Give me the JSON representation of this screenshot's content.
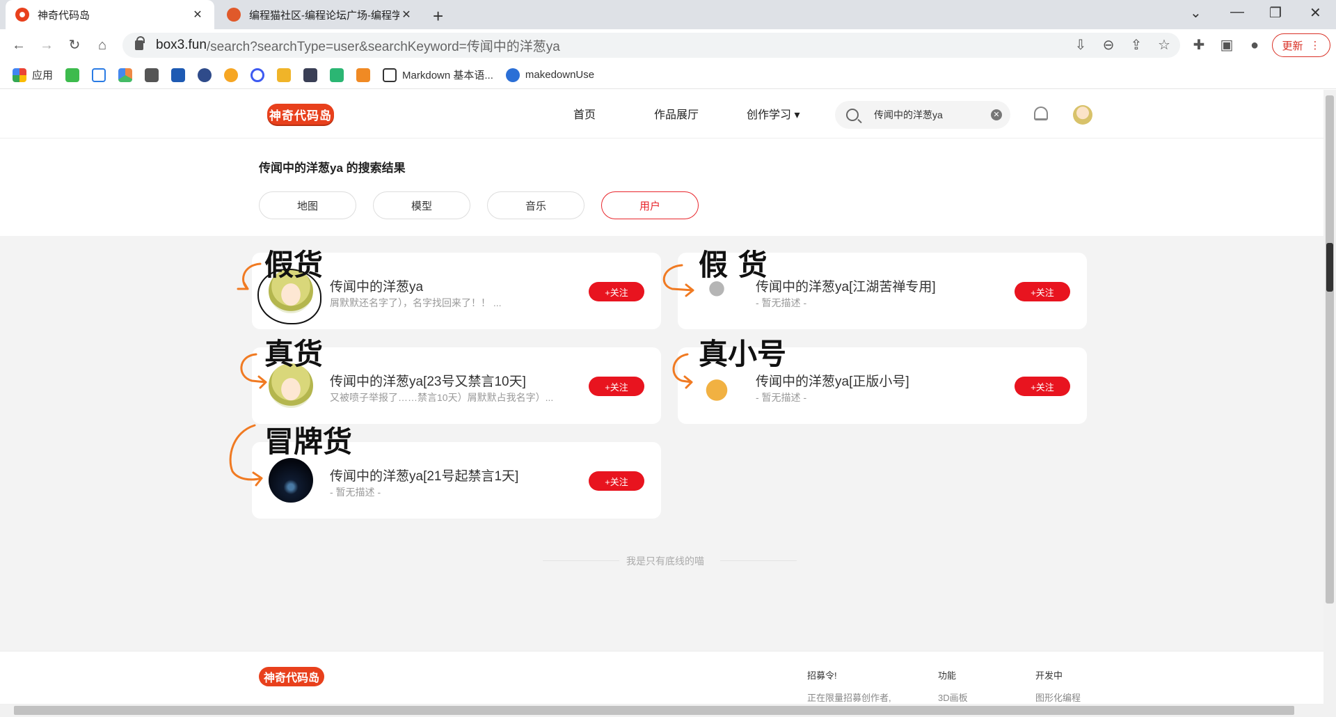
{
  "browser": {
    "tabs": [
      {
        "title": "神奇代码岛",
        "active": true
      },
      {
        "title": "编程猫社区-编程论坛广场-编程学",
        "active": false
      }
    ],
    "address": {
      "domain": "box3.fun",
      "path": "/search?searchType=user&searchKeyword=传闻中的洋葱ya"
    },
    "update_label": "更新",
    "bookmarks": [
      {
        "label": "应用",
        "icon": "apps-grid-icon"
      },
      {
        "label": "Markdown 基本语...",
        "icon": "markdown-icon"
      },
      {
        "label": "makedownUse",
        "icon": "edge-icon"
      }
    ]
  },
  "site": {
    "logo_text": "神奇代码岛",
    "nav": {
      "home": "首页",
      "gallery": "作品展厅",
      "learn": "创作学习 ▾"
    },
    "search": {
      "value": "传闻中的洋葱ya"
    }
  },
  "results": {
    "title": "传闻中的洋葱ya 的搜索结果",
    "tabs": [
      "地图",
      "模型",
      "音乐",
      "用户"
    ],
    "active_tab": "用户",
    "follow_label": "+关注",
    "users": [
      {
        "name": "传闻中的洋葱ya",
        "desc": "屑默默还名字了），名字找回来了！！ ...",
        "avatar": "anime-avatar"
      },
      {
        "name": "传闻中的洋葱ya[江湖苦禅专用]",
        "desc": "- 暂无描述 -",
        "avatar": "skull-avatar"
      },
      {
        "name": "传闻中的洋葱ya[23号又禁言10天]",
        "desc": "又被喷子举报了……禁言10天）屑默默占我名字）...",
        "avatar": "anime-avatar"
      },
      {
        "name": "传闻中的洋葱ya[正版小号]",
        "desc": "- 暂无描述 -",
        "avatar": "deer-avatar"
      },
      {
        "name": "传闻中的洋葱ya[21号起禁言1天]",
        "desc": "- 暂无描述 -",
        "avatar": "space-avatar"
      }
    ],
    "end_text": "我是只有底线的喵"
  },
  "annotations": [
    "假货",
    "假 货",
    "真货",
    "真小号",
    "冒牌货"
  ],
  "footer": {
    "logo_text": "神奇代码岛",
    "columns": [
      {
        "title": "招募令!",
        "item": "正在限量招募创作者,"
      },
      {
        "title": "功能",
        "item": "3D画板"
      },
      {
        "title": "开发中",
        "item": "图形化编程"
      }
    ]
  },
  "colors": {
    "accent": "#e8141f",
    "arrow": "#f07a22",
    "logo": "#e8401c"
  }
}
